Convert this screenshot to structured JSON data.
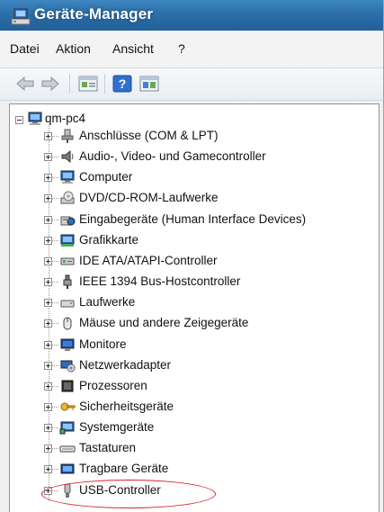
{
  "window": {
    "title": "Geräte-Manager"
  },
  "menu": {
    "items": [
      "Datei",
      "Aktion",
      "Ansicht",
      "?"
    ]
  },
  "toolbar": {
    "buttons": [
      "back-arrow-icon",
      "forward-arrow-icon",
      "properties-icon",
      "help-icon",
      "scan-hardware-icon"
    ]
  },
  "tree": {
    "root": {
      "label": "qm-pc4",
      "icon": "computer-icon"
    },
    "items": [
      {
        "label": "Anschlüsse (COM & LPT)",
        "icon": "port-icon"
      },
      {
        "label": "Audio-, Video- und Gamecontroller",
        "icon": "speaker-icon"
      },
      {
        "label": "Computer",
        "icon": "computer-icon"
      },
      {
        "label": "DVD/CD-ROM-Laufwerke",
        "icon": "dvd-drive-icon"
      },
      {
        "label": "Eingabegeräte (Human Interface Devices)",
        "icon": "hid-icon"
      },
      {
        "label": "Grafikkarte",
        "icon": "display-adapter-icon"
      },
      {
        "label": "IDE ATA/ATAPI-Controller",
        "icon": "ide-controller-icon"
      },
      {
        "label": "IEEE 1394 Bus-Hostcontroller",
        "icon": "firewire-icon"
      },
      {
        "label": "Laufwerke",
        "icon": "disk-drive-icon"
      },
      {
        "label": "Mäuse und andere Zeigegeräte",
        "icon": "mouse-icon"
      },
      {
        "label": "Monitore",
        "icon": "monitor-icon"
      },
      {
        "label": "Netzwerkadapter",
        "icon": "network-adapter-icon"
      },
      {
        "label": "Prozessoren",
        "icon": "processor-icon"
      },
      {
        "label": "Sicherheitsgeräte",
        "icon": "security-device-icon"
      },
      {
        "label": "Systemgeräte",
        "icon": "system-device-icon"
      },
      {
        "label": "Tastaturen",
        "icon": "keyboard-icon"
      },
      {
        "label": "Tragbare Geräte",
        "icon": "portable-device-icon"
      },
      {
        "label": "USB-Controller",
        "icon": "usb-controller-icon",
        "highlighted": true
      }
    ]
  },
  "colors": {
    "titlebar": "#2c6fa9",
    "highlight_circle": "#d8222a"
  }
}
